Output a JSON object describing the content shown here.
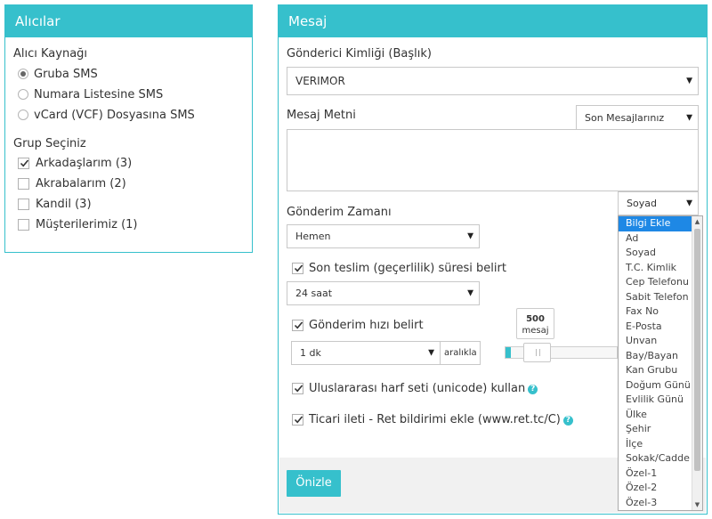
{
  "recipients": {
    "title": "Alıcılar",
    "source_label": "Alıcı Kaynağı",
    "source_options": [
      "Gruba SMS",
      "Numara Listesine SMS",
      "vCard (VCF) Dosyasına SMS"
    ],
    "selected_source": "Gruba SMS",
    "group_label": "Grup Seçiniz",
    "groups": [
      {
        "label": "Arkadaşlarım (3)",
        "checked": true
      },
      {
        "label": "Akrabalarım (2)",
        "checked": false
      },
      {
        "label": "Kandil (3)",
        "checked": false
      },
      {
        "label": "Müşterilerimiz (1)",
        "checked": false
      }
    ]
  },
  "message": {
    "title": "Mesaj",
    "sender_label": "Gönderici Kimliği (Başlık)",
    "sender_value": "VERIMOR",
    "text_label": "Mesaj Metni",
    "recent_select": "Son Mesajlarınız",
    "text_value": "",
    "field_select": "Soyad",
    "field_options": [
      "Bilgi Ekle",
      "Ad",
      "Soyad",
      "T.C. Kimlik",
      "Cep Telefonu",
      "Sabit Telefon",
      "Fax No",
      "E-Posta",
      "Unvan",
      "Bay/Bayan",
      "Kan Grubu",
      "Doğum Günü",
      "Evlilik Günü",
      "Ülke",
      "Şehir",
      "İlçe",
      "Sokak/Cadde",
      "Özel-1",
      "Özel-2",
      "Özel-3"
    ],
    "field_highlighted": "Bilgi Ekle",
    "send_time_label": "Gönderim Zamanı",
    "send_time_value": "Hemen",
    "validity_checkbox": {
      "label": "Son teslim (geçerlilik) süresi belirt",
      "checked": true
    },
    "validity_value": "24 saat",
    "speed_checkbox": {
      "label": "Gönderim hızı belirt",
      "checked": true
    },
    "speed_interval": "1 dk",
    "speed_interval_suffix": "aralıkla",
    "speed_tooltip_value": "500",
    "speed_tooltip_unit": "mesaj",
    "speed_slider_fraction": 0.04,
    "unicode_checkbox": {
      "label": "Uluslararası harf seti (unicode) kullan",
      "checked": true
    },
    "ret_checkbox": {
      "label": "Ticari ileti - Ret bildirimi ekle (www.ret.tc/C)",
      "checked": true
    },
    "help_glyph": "?",
    "preview_button": "Önizle"
  },
  "colors": {
    "accent": "#36c0cc",
    "highlight": "#1e88e5"
  },
  "icons": {
    "arrow": "▼",
    "check": "check-icon"
  }
}
